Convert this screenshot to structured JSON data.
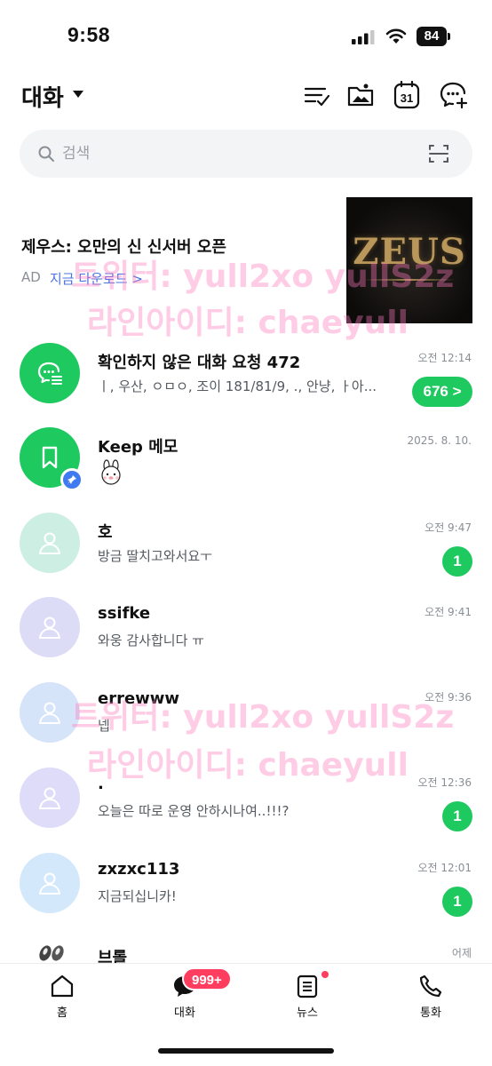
{
  "status_bar": {
    "time": "9:58",
    "battery": "84"
  },
  "header": {
    "title": "대화"
  },
  "search": {
    "placeholder": "검색"
  },
  "ad": {
    "title": "제우스: 오만의 신 신서버 오픈",
    "label": "AD",
    "link": "지금 다운로드 >",
    "image_text": "ZEUS"
  },
  "chats": [
    {
      "name": "확인하지 않은 대화 요청 472",
      "preview": "ㅣ, 우산, ㅇㅁㅇ, 조이 181/81/9, ., 안냥, ㅏ아...",
      "time": "오전 12:14",
      "unread": "676 >",
      "avatar_color": "#1ec95f",
      "avatar_icon": "chat-request-icon"
    },
    {
      "name": "Keep 메모",
      "preview": "",
      "time": "2025. 8. 10.",
      "unread": "",
      "avatar_color": "#1ec95f",
      "avatar_icon": "bookmark-icon",
      "sticker": "brown-bunny-sticker"
    },
    {
      "name": "호",
      "preview": "방금 딸치고와서요ㅜ",
      "time": "오전 9:47",
      "unread": "1",
      "avatar_color": "#cdeee3",
      "avatar_icon": "person-icon"
    },
    {
      "name": "ssifke",
      "preview": "와웅 감사합니다 ㅠ",
      "time": "오전 9:41",
      "unread": "",
      "avatar_color": "#dcdcf7",
      "avatar_icon": "person-icon"
    },
    {
      "name": "errewww",
      "preview": "넵",
      "time": "오전 9:36",
      "unread": "",
      "avatar_color": "#d6e4fa",
      "avatar_icon": "person-icon"
    },
    {
      "name": ".",
      "preview": "오늘은 따로 운영 안하시나여..!!!?",
      "time": "오전 12:36",
      "unread": "1",
      "avatar_color": "#dedcf8",
      "avatar_icon": "person-icon"
    },
    {
      "name": "zxzxc113",
      "preview": " 지금되십니카!",
      "time": "오전 12:01",
      "unread": "1",
      "avatar_color": "#d3e9fb",
      "avatar_icon": "person-icon"
    },
    {
      "name": "브롤",
      "preview": "",
      "time": "어제",
      "unread": "",
      "avatar_color": "#ffffff",
      "avatar_icon": "character-avatar"
    }
  ],
  "watermarks": [
    "트위터: yull2xo yullS2z",
    "라인아이디: chaeyull",
    "트위터: yull2xo yullS2z",
    "라인아이디: chaeyull"
  ],
  "bottom_nav": [
    {
      "label": "홈",
      "icon": "home-icon"
    },
    {
      "label": "대화",
      "icon": "chat-icon",
      "badge": "999+"
    },
    {
      "label": "뉴스",
      "icon": "news-icon"
    },
    {
      "label": "통화",
      "icon": "phone-icon"
    }
  ],
  "colors": {
    "accent_green": "#1ec95f",
    "badge_red": "#ff3e5f",
    "link_blue": "#4a73e0"
  }
}
